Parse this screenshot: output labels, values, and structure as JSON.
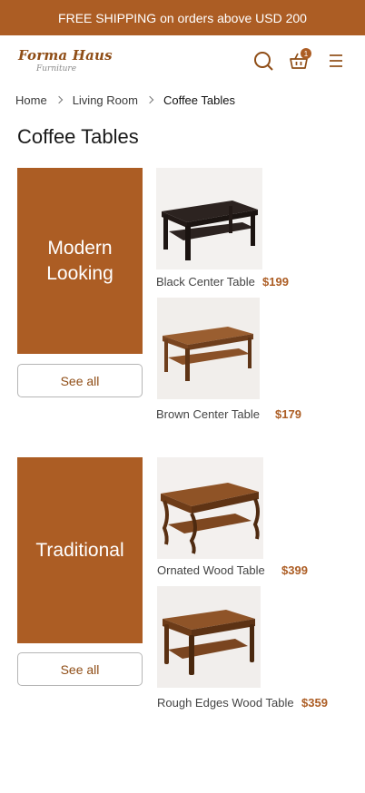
{
  "promo": {
    "text": "FREE SHIPPING on orders above USD 200"
  },
  "brand": {
    "name": "Forma Haus",
    "tagline": "Furniture"
  },
  "header": {
    "cart_count": "1",
    "search_icon": "search-icon",
    "cart_icon": "shopping-basket-icon",
    "menu_icon": "hamburger-menu-icon"
  },
  "breadcrumb": {
    "items": [
      "Home",
      "Living Room",
      "Coffee Tables"
    ]
  },
  "page": {
    "title": "Coffee Tables"
  },
  "sections": [
    {
      "banner": "Modern Looking",
      "see_all": "See all",
      "products": [
        {
          "name": "Black Center Table",
          "price": "$199"
        },
        {
          "name": "Brown Center Table",
          "price": "$179"
        }
      ]
    },
    {
      "banner": "Traditional",
      "see_all": "See all",
      "products": [
        {
          "name": "Ornated Wood Table",
          "price": "$399"
        },
        {
          "name": "Rough Edges Wood Table",
          "price": "$359"
        }
      ]
    }
  ],
  "colors": {
    "accent": "#ac5d24",
    "accent_dark": "#8f4d16",
    "dark_wood": "#3a2a22",
    "brown_wood": "#8a5128"
  }
}
